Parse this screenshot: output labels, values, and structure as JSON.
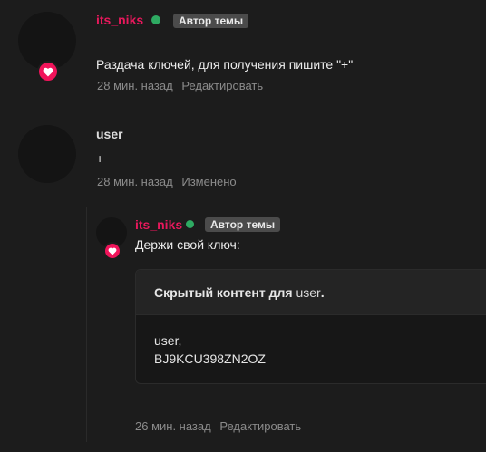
{
  "post1": {
    "author": "its_niks",
    "badge": "Автор темы",
    "text": "Раздача ключей, для получения пишите \"+\"",
    "time": "28 мин. назад",
    "action": "Редактировать"
  },
  "post2": {
    "author": "user",
    "text": "+",
    "time": "28 мин. назад",
    "status": "Изменено"
  },
  "reply": {
    "author": "its_niks",
    "badge": "Автор темы",
    "text": "Держи свой ключ:",
    "hidden": {
      "title_prefix": "Скрытый контент для ",
      "title_user": "user",
      "title_suffix": ".",
      "line1": "user,",
      "line2": "BJ9KCU398ZN2OZ"
    },
    "time": "26 мин. назад",
    "action": "Редактировать"
  },
  "colors": {
    "background": "#1c1c1c",
    "author": "#e8185c",
    "online": "#2eaa62",
    "badge_bg": "#4b4b4b",
    "meta": "#8b8b8b"
  },
  "icons": [
    "heart-icon",
    "online-dot-icon"
  ]
}
